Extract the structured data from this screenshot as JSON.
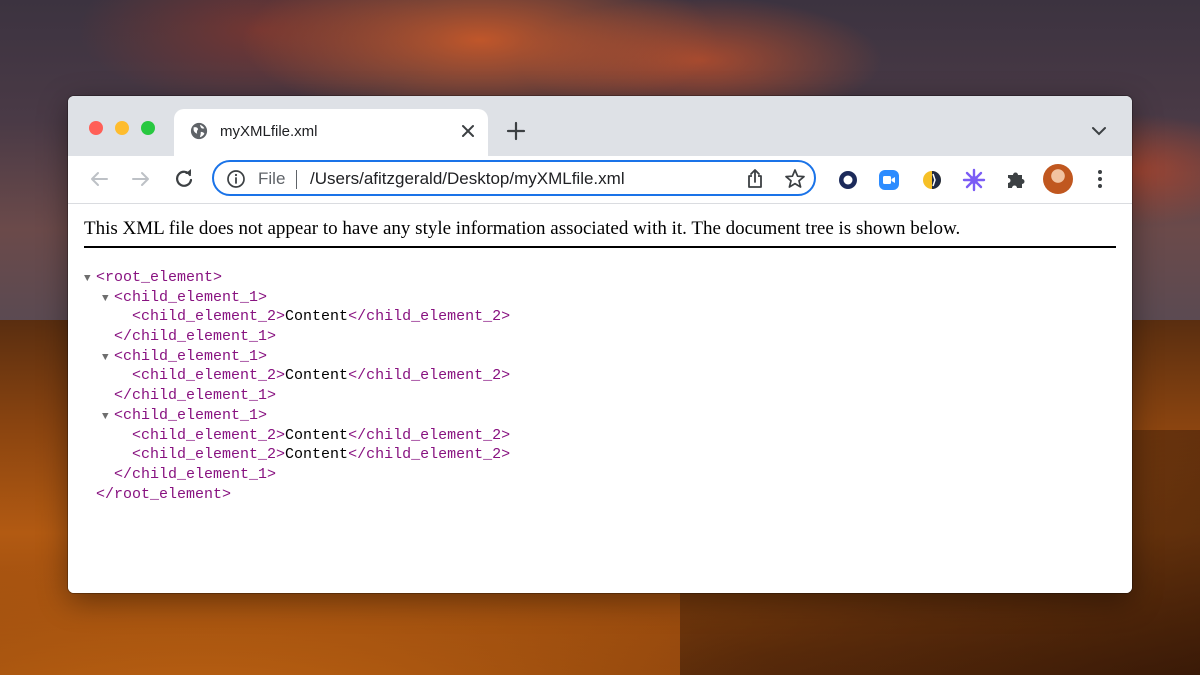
{
  "tab": {
    "title": "myXMLfile.xml"
  },
  "omnibox": {
    "scheme": "File",
    "url": "/Users/afitzgerald/Desktop/myXMLfile.xml"
  },
  "colors": {
    "accent": "#1a73e8",
    "tag": "#881280",
    "tabbar": "#dee1e6"
  },
  "icons": {
    "tab": "globe-icon",
    "close": "close-icon",
    "new_tab": "plus-icon",
    "tab_menu": "chevron-down-icon",
    "back": "back-arrow-icon",
    "forward": "forward-arrow-icon",
    "reload": "reload-icon",
    "info": "info-icon",
    "share": "share-icon",
    "bookmark": "star-icon",
    "extensions": [
      "ring-extension-icon",
      "video-extension-icon",
      "flag-extension-icon",
      "sparkle-extension-icon",
      "puzzle-icon"
    ],
    "menu": "kebab-menu-icon"
  },
  "page": {
    "notice": "This XML file does not appear to have any style information associated with it. The document tree is shown below.",
    "collapse_glyph": "▼",
    "tree": [
      {
        "collapsible": true,
        "indent": "",
        "tag": "<root_element>",
        "text": "",
        "close": ""
      },
      {
        "collapsible": true,
        "indent": "  ",
        "tag": "<child_element_1>",
        "text": "",
        "close": ""
      },
      {
        "collapsible": false,
        "indent": "    ",
        "tag": "<child_element_2>",
        "text": "Content",
        "close": "</child_element_2>"
      },
      {
        "collapsible": false,
        "indent": "  ",
        "tag": "</child_element_1>",
        "text": "",
        "close": ""
      },
      {
        "collapsible": true,
        "indent": "  ",
        "tag": "<child_element_1>",
        "text": "",
        "close": ""
      },
      {
        "collapsible": false,
        "indent": "    ",
        "tag": "<child_element_2>",
        "text": "Content",
        "close": "</child_element_2>"
      },
      {
        "collapsible": false,
        "indent": "  ",
        "tag": "</child_element_1>",
        "text": "",
        "close": ""
      },
      {
        "collapsible": true,
        "indent": "  ",
        "tag": "<child_element_1>",
        "text": "",
        "close": ""
      },
      {
        "collapsible": false,
        "indent": "    ",
        "tag": "<child_element_2>",
        "text": "Content",
        "close": "</child_element_2>"
      },
      {
        "collapsible": false,
        "indent": "    ",
        "tag": "<child_element_2>",
        "text": "Content",
        "close": "</child_element_2>"
      },
      {
        "collapsible": false,
        "indent": "  ",
        "tag": "</child_element_1>",
        "text": "",
        "close": ""
      },
      {
        "collapsible": false,
        "indent": "",
        "tag": "</root_element>",
        "text": "",
        "close": ""
      }
    ]
  }
}
